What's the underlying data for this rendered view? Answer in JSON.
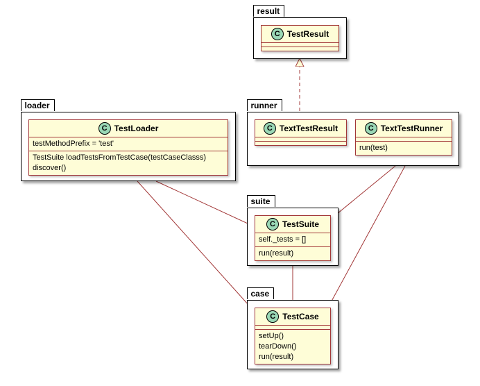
{
  "packages": {
    "result": {
      "label": "result"
    },
    "loader": {
      "label": "loader"
    },
    "runner": {
      "label": "runner"
    },
    "suite": {
      "label": "suite"
    },
    "case": {
      "label": "case"
    }
  },
  "classes": {
    "test_result": {
      "name": "TestResult",
      "stereotype": "C"
    },
    "test_loader": {
      "name": "TestLoader",
      "stereotype": "C",
      "attrs": [
        "testMethodPrefix = 'test'"
      ],
      "ops": [
        "TestSuite loadTestsFromTestCase(testCaseClasss)",
        "discover()"
      ]
    },
    "text_test_result": {
      "name": "TextTestResult",
      "stereotype": "C"
    },
    "text_test_runner": {
      "name": "TextTestRunner",
      "stereotype": "C",
      "ops": [
        "run(test)"
      ]
    },
    "test_suite": {
      "name": "TestSuite",
      "stereotype": "C",
      "attrs": [
        "self._tests = []"
      ],
      "ops": [
        "run(result)"
      ]
    },
    "test_case": {
      "name": "TestCase",
      "stereotype": "C",
      "ops": [
        "setUp()",
        "tearDown()",
        "run(result)"
      ]
    }
  },
  "relations": [
    {
      "from": "text_test_result",
      "to": "test_result",
      "type": "generalization"
    },
    {
      "from": "test_loader",
      "to": "test_suite",
      "type": "dependency"
    },
    {
      "from": "test_loader",
      "to": "test_case",
      "type": "dependency"
    },
    {
      "from": "text_test_runner",
      "to": "test_suite",
      "type": "dependency"
    },
    {
      "from": "text_test_runner",
      "to": "test_case",
      "type": "dependency"
    },
    {
      "from": "test_suite",
      "to": "test_case",
      "type": "dependency"
    }
  ],
  "colors": {
    "class_fill": "#fefdd7",
    "class_border": "#a23737",
    "stereotype_fill": "#9ad8b5",
    "arrow": "#a23737"
  }
}
